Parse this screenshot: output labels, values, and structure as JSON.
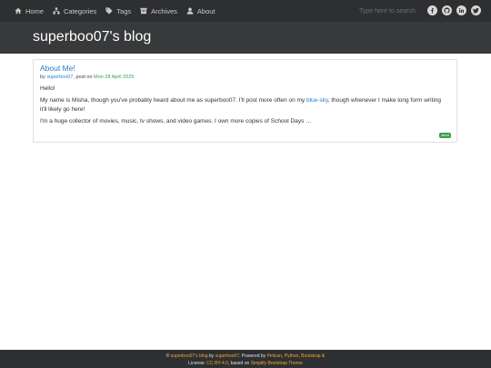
{
  "nav": {
    "items": [
      {
        "label": "Home",
        "icon": "home-icon"
      },
      {
        "label": "Categories",
        "icon": "sitemap-icon"
      },
      {
        "label": "Tags",
        "icon": "tag-icon"
      },
      {
        "label": "Archives",
        "icon": "archive-icon"
      },
      {
        "label": "About",
        "icon": "user-icon"
      }
    ],
    "search_placeholder": "Type here to search",
    "social": [
      "facebook-icon",
      "github-icon",
      "linkedin-icon",
      "twitter-icon"
    ]
  },
  "header": {
    "title": "superboo07's blog"
  },
  "article": {
    "title": "About Me!",
    "byline_prefix": "by ",
    "author": "superboo07",
    "byline_mid": ", post on ",
    "date": "Mon 28 April 2025",
    "p1": "Hello!",
    "p2_before": "My name is Misha, though you've probably heard about me as superboo07. I'll post more often on my ",
    "p2_link": "blue-sky",
    "p2_after": ", though whenever I make long form writing it'll likely go here!",
    "p3": "I'm a huge collector of movies, music, tv shows, and video games. I own more copies of School Days …",
    "tag": "about"
  },
  "footer": {
    "copyright": "© ",
    "site_link": "superboo07's blog",
    "by": " by ",
    "author_link": "superboo07",
    "powered": ". Powered by ",
    "pelican": "Pelican",
    "comma1": ", ",
    "python": "Python",
    "comma2": ", ",
    "bootstrap": "Bootstrap",
    "amp": " &",
    "license_prefix": "License: ",
    "license_link": "CC-BY-4.0",
    "based": ", based on ",
    "theme_link": "Simplify Bootstrap Theme"
  },
  "colors": {
    "link": "#2a7bd1",
    "date": "#39a146",
    "tag_bg": "#36a148",
    "footer_link": "#f0a830",
    "topbar": "#2e2f31",
    "header": "#38393b"
  }
}
